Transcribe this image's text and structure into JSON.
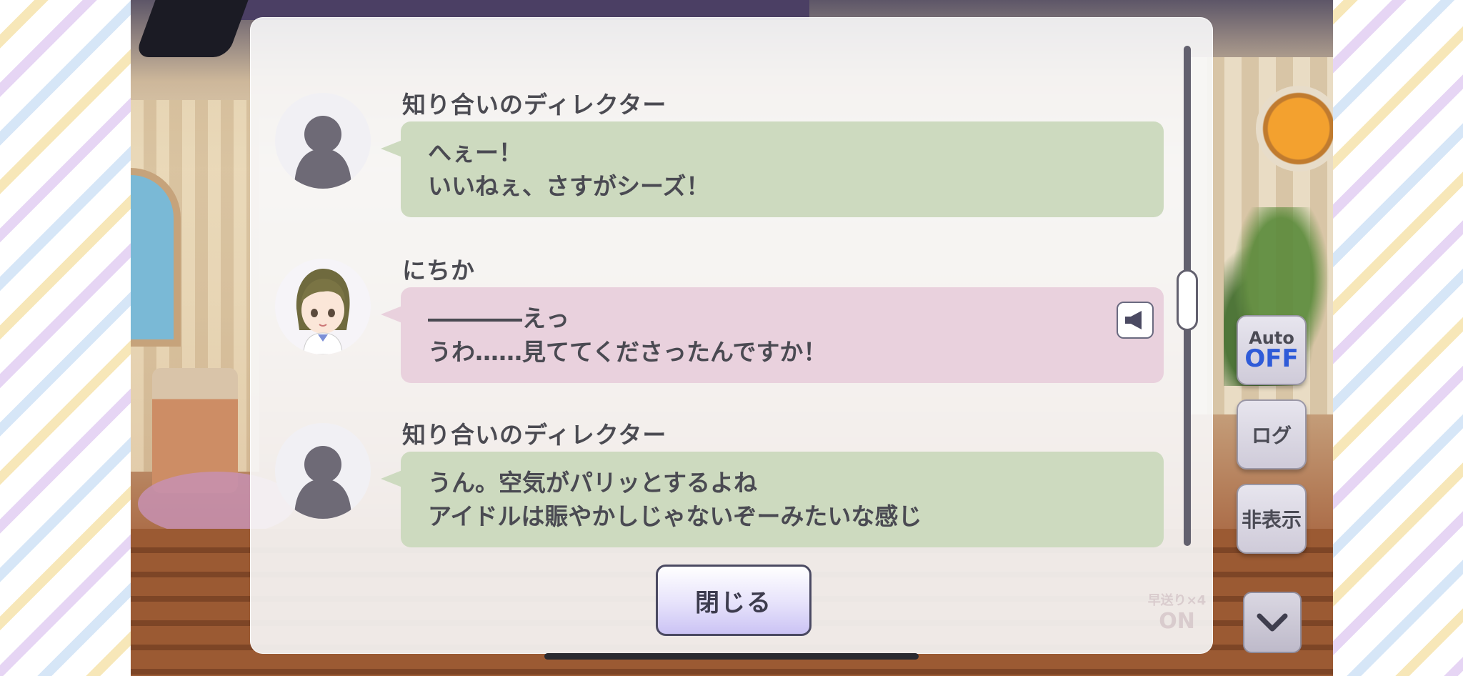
{
  "log": {
    "entries": [
      {
        "speaker": "知り合いのディレクター",
        "lines": [
          "へぇー！",
          "いいねぇ、さすがシーズ！"
        ],
        "avatar": "silhouette-icon",
        "bubble_color": "#cddabf",
        "has_voice": false
      },
      {
        "speaker": "にちか",
        "lines": [
          "――――えっ",
          "うわ……見ててくださったんですか！"
        ],
        "avatar": "character-portrait",
        "bubble_color": "#e9d1dd",
        "has_voice": true
      },
      {
        "speaker": "知り合いのディレクター",
        "lines": [
          "うん。空気がパリッとするよね",
          "アイドルは賑やかしじゃないぞーみたいな感じ"
        ],
        "avatar": "silhouette-icon",
        "bubble_color": "#cddabf",
        "has_voice": false
      }
    ],
    "close_label": "閉じる"
  },
  "controls": {
    "auto_label": "Auto",
    "auto_state": "OFF",
    "log_label": "ログ",
    "hide_label": "非表示",
    "fast_forward_label": "早送り×4",
    "fast_forward_state": "ON"
  },
  "colors": {
    "accent_blue": "#2f5bd8",
    "text_dark": "#4a4a52"
  }
}
